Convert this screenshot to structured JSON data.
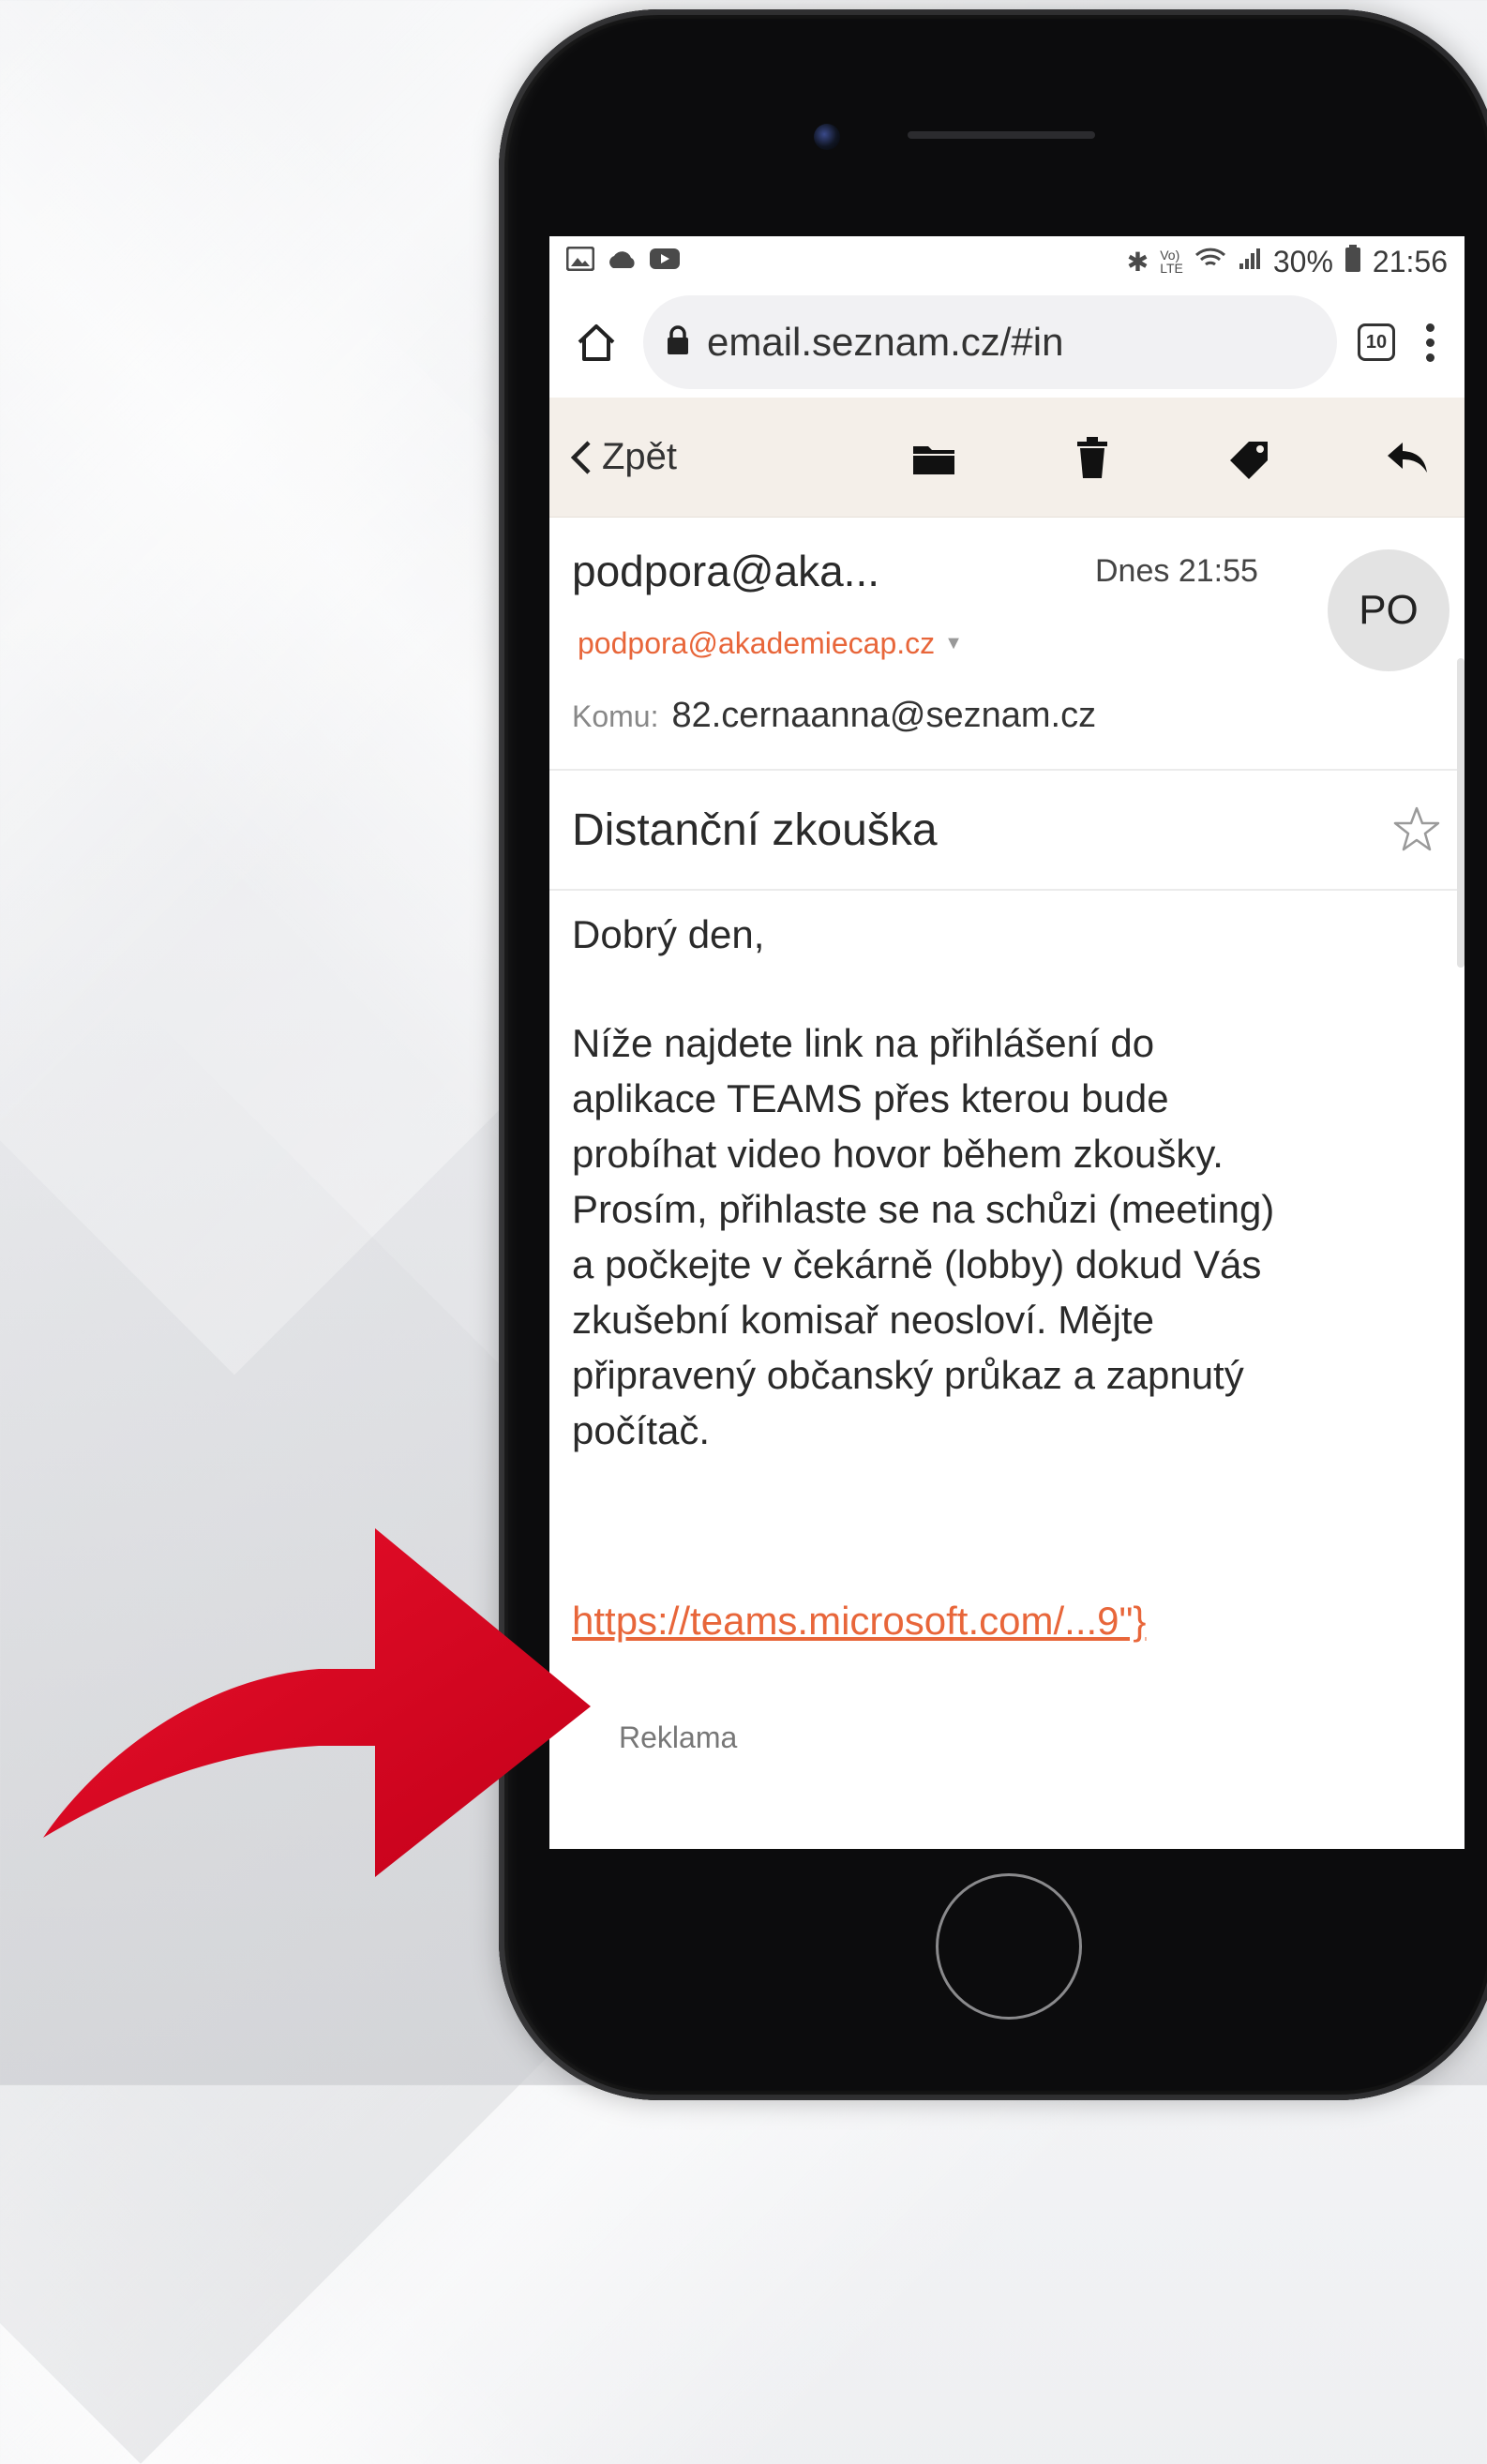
{
  "statusbar": {
    "left_icons": [
      "gallery-icon",
      "cloud-icon",
      "youtube-icon"
    ],
    "bluetooth": "✱",
    "volte": "Vo)\nLTE",
    "battery": "30%",
    "time": "21:56"
  },
  "browser": {
    "url": "email.seznam.cz/#in",
    "tabs_count": "10"
  },
  "toolbar": {
    "back_label": "Zpět"
  },
  "message": {
    "sender_name": "podpora@aka...",
    "time": "Dnes 21:55",
    "avatar_initials": "PO",
    "sender_email": "podpora@akademiecap.cz",
    "to_label": "Komu:",
    "to_value": "82.cernaanna@seznam.cz",
    "subject": "Distanční zkouška",
    "greeting": "Dobrý den,",
    "body_lines": [
      "Níže najdete link na přihlášení do",
      "aplikace TEAMS přes kterou bude",
      "probíhat video hovor během zkoušky.",
      "Prosím, přihlaste se na schůzi (meeting)",
      "a počkejte v čekárně (lobby) dokud Vás",
      "zkušební komisař neosloví. Mějte",
      "připravený občanský průkaz a zapnutý",
      "počítač."
    ],
    "link_text": "https://teams.microsoft.com/...9\"}",
    "ad_label": "Reklama"
  },
  "colors": {
    "accent": "#e8663a",
    "toolbar_bg": "#f4efe9",
    "arrow": "#d9001c"
  }
}
